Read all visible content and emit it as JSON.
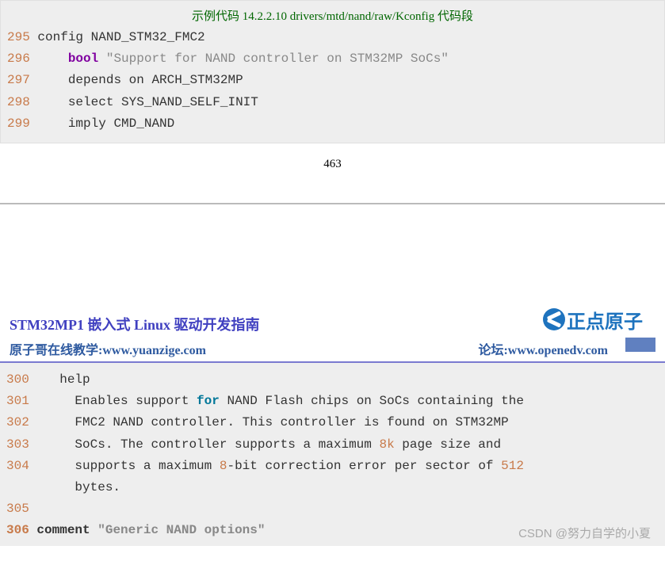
{
  "top": {
    "title": "示例代码 14.2.2.10 drivers/mtd/nand/raw/Kconfig 代码段",
    "lines": [
      {
        "n": "295",
        "pre": " ",
        "txt": "config NAND_STM32_FMC2"
      },
      {
        "n": "296",
        "pre": "     ",
        "kw": "bool",
        "after": " ",
        "str": "\"Support for NAND controller on STM32MP SoCs\""
      },
      {
        "n": "297",
        "pre": "     ",
        "txt": "depends on ARCH_STM32MP"
      },
      {
        "n": "298",
        "pre": "     ",
        "txt": "select SYS_NAND_SELF_INIT"
      },
      {
        "n": "299",
        "pre": "     ",
        "txt": "imply CMD_NAND"
      }
    ],
    "page_num": "463"
  },
  "header": {
    "doc_title": "STM32MP1 嵌入式 Linux 驱动开发指南",
    "logo_text": "正点原子",
    "left": "原子哥在线教学:www.yuanzige.com",
    "right": "论坛:www.openedv.com"
  },
  "bottom": {
    "lines": [
      {
        "n": "300",
        "pre": "    ",
        "txt": "help"
      },
      {
        "n": "301",
        "pre": "      ",
        "txt_a": "Enables support ",
        "kw": "for",
        "txt_b": " NAND Flash chips on SoCs containing the"
      },
      {
        "n": "302",
        "pre": "      ",
        "txt": "FMC2 NAND controller. This controller is found on STM32MP"
      },
      {
        "n": "303",
        "pre": "      ",
        "txt_a": "SoCs. The controller supports a maximum ",
        "num": "8k",
        "txt_b": " page size and"
      },
      {
        "n": "304",
        "pre": "      ",
        "txt_a": "supports a maximum ",
        "num": "8",
        "txt_b": "-bit correction error per sector of ",
        "num2": "512"
      },
      {
        "n": "   ",
        "pre": "      ",
        "txt": "bytes."
      },
      {
        "n": "305",
        "pre": "",
        "txt": ""
      },
      {
        "n": "306",
        "pre": " ",
        "bold": true,
        "txt_a": "comment ",
        "str": "\"Generic NAND options\""
      }
    ]
  },
  "watermark": "CSDN @努力自学的小夏"
}
